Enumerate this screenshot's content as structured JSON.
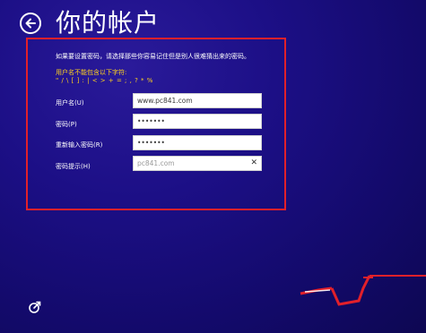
{
  "header": {
    "title": "你的帐户"
  },
  "form": {
    "intro": "如果要设置密码，请选择那些你容易记住但是别人很难猜出来的密码。",
    "warning_title": "用户名不能包含以下字符:",
    "warning_chars": "\" / \\ [ ] : | < > + = ; , ? * %",
    "username_label": "用户名(U)",
    "username_value": "www.pc841.com",
    "password_label": "密码(P)",
    "password_value": "•••••••",
    "confirm_label": "重新输入密码(R)",
    "confirm_value": "•••••••",
    "hint_label": "密码提示(H)",
    "hint_value": "pc841.com",
    "clear_glyph": "✕"
  },
  "colors": {
    "background": "#1c0f86",
    "highlight_border": "#e2202a",
    "warning_text": "#ffd21c"
  }
}
